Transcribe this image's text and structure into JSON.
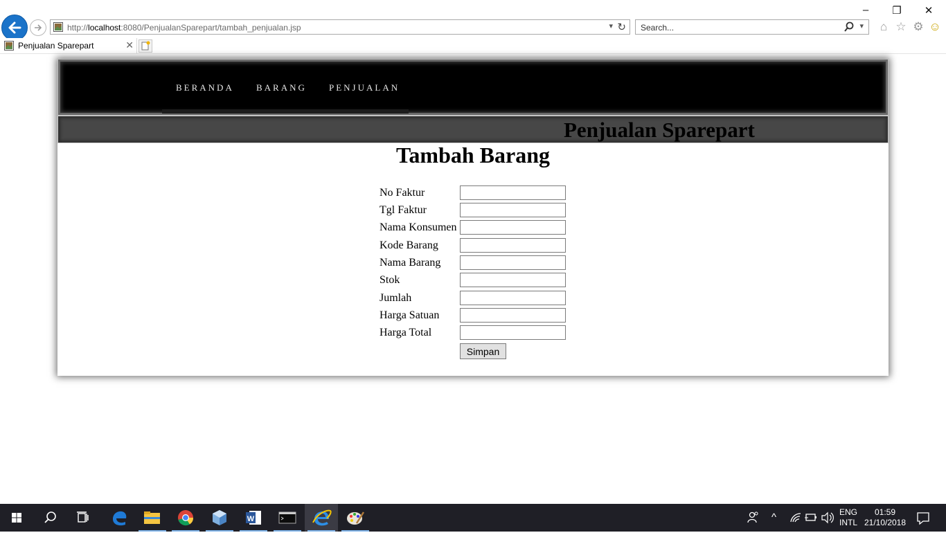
{
  "browser": {
    "url_prefix": "http://",
    "url_host": "localhost",
    "url_rest": ":8080/PenjualanSparepart/tambah_penjualan.jsp",
    "search_placeholder": "Search...",
    "tab_title": "Penjualan Sparepart",
    "icons": [
      "back-icon",
      "forward-icon",
      "refresh-icon",
      "search-icon",
      "home-icon",
      "favorites-star-icon",
      "settings-gear-icon",
      "smiley-feedback-icon"
    ]
  },
  "nav": {
    "items": [
      {
        "label": "BERANDA"
      },
      {
        "label": "BARANG"
      },
      {
        "label": "PENJUALAN"
      }
    ]
  },
  "site": {
    "title": "Penjualan Sparepart"
  },
  "page": {
    "title": "Tambah Barang"
  },
  "form": {
    "fields": [
      {
        "label": "No Faktur",
        "value": ""
      },
      {
        "label": "Tgl Faktur",
        "value": ""
      },
      {
        "label": "Nama Konsumen",
        "value": ""
      },
      {
        "label": "Kode Barang",
        "value": ""
      },
      {
        "label": "Nama Barang",
        "value": ""
      },
      {
        "label": "Stok",
        "value": ""
      },
      {
        "label": "Jumlah",
        "value": ""
      },
      {
        "label": "Harga Satuan",
        "value": ""
      },
      {
        "label": "Harga Total",
        "value": ""
      }
    ],
    "submit_label": "Simpan"
  },
  "taskbar": {
    "apps": [
      "start-icon",
      "search-icon",
      "task-view-icon",
      "edge-icon",
      "file-explorer-icon",
      "chrome-icon",
      "box-app-icon",
      "word-icon",
      "cmd-icon",
      "internet-explorer-icon",
      "paint-icon"
    ],
    "language_1": "ENG",
    "language_2": "INTL",
    "time": "01:59",
    "date": "21/10/2018"
  },
  "colors": {
    "header_bg": "#000000",
    "subheader_bg": "#474747",
    "ie_blue": "#1a73c9",
    "taskbar_bg": "#1f1f26"
  }
}
